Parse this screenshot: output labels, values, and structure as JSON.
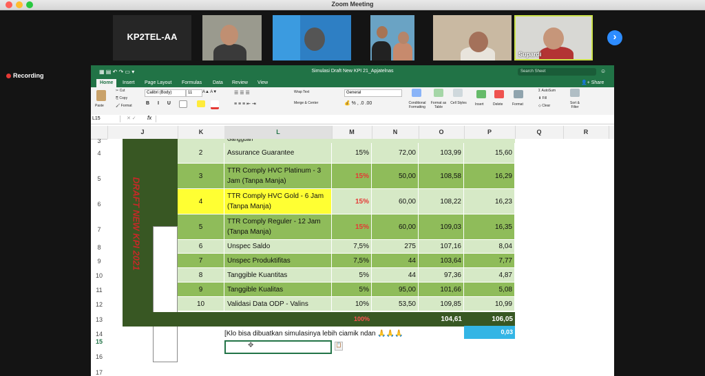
{
  "window": {
    "title": "Zoom Meeting"
  },
  "participants": [
    {
      "name": "KP2TEL-AA"
    },
    {
      "name": ""
    },
    {
      "name": ""
    },
    {
      "name": ""
    },
    {
      "name": ""
    },
    {
      "name": "Supardi"
    }
  ],
  "recording_label": "Recording",
  "excel": {
    "doc_title": "Simulasi Draft New KPI 21_Apjatelnas",
    "search_placeholder": "Search Sheet",
    "share_label": "Share",
    "tabs": [
      "Home",
      "Insert",
      "Page Layout",
      "Formulas",
      "Data",
      "Review",
      "View"
    ],
    "ribbon": {
      "paste": "Paste",
      "cut": "Cut",
      "copy": "Copy",
      "format": "Format",
      "font": "Calibri (Body)",
      "size": "11",
      "wrap_text": "Wrap Text",
      "merge_center": "Merge & Center",
      "number_format": "General",
      "conditional": "Conditional Formatting",
      "format_table": "Format as Table",
      "cell_styles": "Cell Styles",
      "insert": "Insert",
      "delete": "Delete",
      "format2": "Format",
      "autosum": "AutoSum",
      "fill": "Fill",
      "clear": "Clear",
      "sort": "Sort & Filter"
    },
    "name_box": "L15",
    "fx": "fx",
    "columns": [
      "J",
      "K",
      "L",
      "M",
      "N",
      "O",
      "P",
      "Q",
      "R"
    ],
    "row_numbers": [
      "3",
      "4",
      "5",
      "6",
      "7",
      "8",
      "9",
      "10",
      "11",
      "12",
      "13",
      "14",
      "15",
      "16",
      "17"
    ],
    "side_label": "DRAFT NEW KPI 2021",
    "rows": [
      {
        "no": "2",
        "kpi": "Assurance Guarantee",
        "bobot": "15%",
        "target": "72,00",
        "real": "103,99",
        "score": "15,60",
        "hl": false,
        "bobot_red": false
      },
      {
        "no": "3",
        "kpi": "TTR Comply HVC Platinum - 3 Jam (Tanpa Manja)",
        "bobot": "15%",
        "target": "50,00",
        "real": "108,58",
        "score": "16,29",
        "hl": false,
        "bobot_red": true
      },
      {
        "no": "4",
        "kpi": "TTR Comply HVC Gold - 6 Jam (Tanpa Manja)",
        "bobot": "15%",
        "target": "60,00",
        "real": "108,22",
        "score": "16,23",
        "hl": true,
        "bobot_red": true
      },
      {
        "no": "5",
        "kpi": "TTR Comply Reguler - 12 Jam (Tanpa Manja)",
        "bobot": "15%",
        "target": "60,00",
        "real": "109,03",
        "score": "16,35",
        "hl": false,
        "bobot_red": true
      },
      {
        "no": "6",
        "kpi": "Unspec Saldo",
        "bobot": "7,5%",
        "target": "275",
        "real": "107,16",
        "score": "8,04",
        "hl": false,
        "bobot_red": false
      },
      {
        "no": "7",
        "kpi": "Unspec Produktifitas",
        "bobot": "7,5%",
        "target": "44",
        "real": "103,64",
        "score": "7,77",
        "hl": false,
        "bobot_red": false
      },
      {
        "no": "8",
        "kpi": "Tanggible Kuantitas",
        "bobot": "5%",
        "target": "44",
        "real": "97,36",
        "score": "4,87",
        "hl": false,
        "bobot_red": false
      },
      {
        "no": "9",
        "kpi": "Tanggible Kualitas",
        "bobot": "5%",
        "target": "95,00",
        "real": "101,66",
        "score": "5,08",
        "hl": false,
        "bobot_red": false
      },
      {
        "no": "10",
        "kpi": "Validasi Data ODP - Valins",
        "bobot": "10%",
        "target": "53,50",
        "real": "109,85",
        "score": "10,99",
        "hl": false,
        "bobot_red": false
      }
    ],
    "partial_top_kpi": "Gangguan",
    "total": {
      "bobot": "100%",
      "real": "104,61",
      "score": "106,05"
    },
    "note": "[Klo bisa dibuatkan simulasinya lebih ciamik ndan 🙏🙏🙏",
    "delta": "0,03",
    "colors": {
      "dark_green": "#385723",
      "mid_green": "#8fbc5a",
      "light_green": "#d6e9c6",
      "yellow": "#ffff33",
      "blue": "#33b5e5",
      "excel_green": "#217346"
    }
  }
}
